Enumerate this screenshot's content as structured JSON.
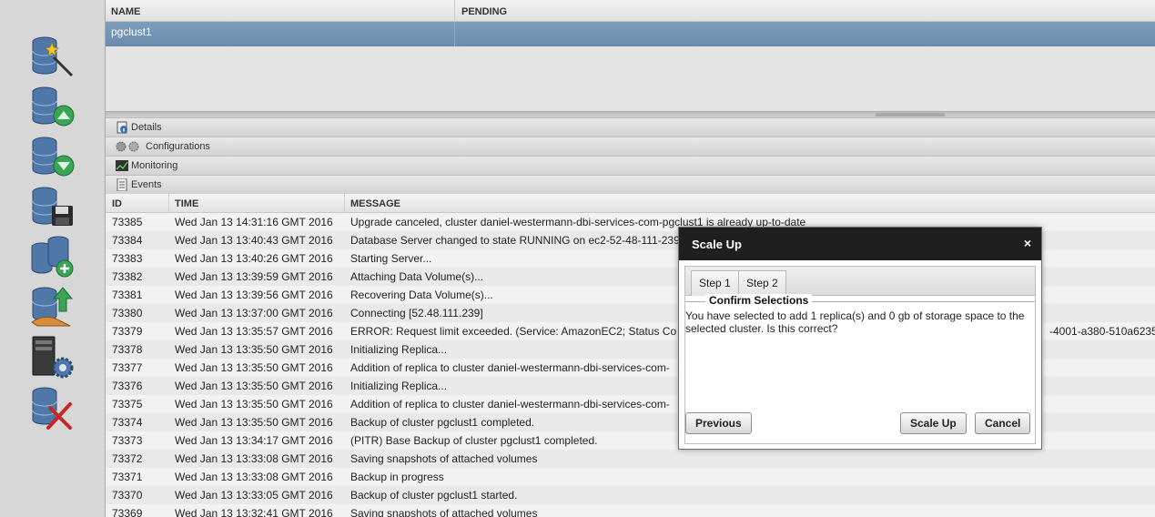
{
  "clusters": {
    "columns": [
      "NAME",
      "PENDING"
    ],
    "rows": [
      {
        "name": "pgclust1",
        "pending": ""
      }
    ]
  },
  "accordion": [
    {
      "label": "Details",
      "icon": "details-icon"
    },
    {
      "label": "Configurations",
      "icon": "configurations-icon"
    },
    {
      "label": "Monitoring",
      "icon": "monitoring-icon"
    },
    {
      "label": "Events",
      "icon": "events-icon"
    }
  ],
  "toolbar": [
    {
      "name": "create-cluster-button",
      "icon": "database-wand-icon"
    },
    {
      "name": "scale-up-button",
      "icon": "database-up-icon"
    },
    {
      "name": "scale-down-button",
      "icon": "database-down-icon"
    },
    {
      "name": "backup-button",
      "icon": "database-save-icon"
    },
    {
      "name": "add-replica-button",
      "icon": "database-add-icon"
    },
    {
      "name": "upgrade-button",
      "icon": "database-upgrade-icon"
    },
    {
      "name": "server-settings-button",
      "icon": "server-gear-icon"
    },
    {
      "name": "delete-cluster-button",
      "icon": "database-delete-icon"
    }
  ],
  "events": {
    "columns": [
      "ID",
      "TIME",
      "MESSAGE"
    ],
    "rows": [
      {
        "id": "73385",
        "time": "Wed Jan 13 14:31:16 GMT 2016",
        "message": "Upgrade canceled, cluster daniel-westermann-dbi-services-com-pgclust1 is already up-to-date"
      },
      {
        "id": "73384",
        "time": "Wed Jan 13 13:40:43 GMT 2016",
        "message": "Database Server changed to state RUNNING on ec2-52-48-111-239"
      },
      {
        "id": "73383",
        "time": "Wed Jan 13 13:40:26 GMT 2016",
        "message": "Starting Server..."
      },
      {
        "id": "73382",
        "time": "Wed Jan 13 13:39:59 GMT 2016",
        "message": "Attaching Data Volume(s)..."
      },
      {
        "id": "73381",
        "time": "Wed Jan 13 13:39:56 GMT 2016",
        "message": "Recovering Data Volume(s)..."
      },
      {
        "id": "73380",
        "time": "Wed Jan 13 13:37:00 GMT 2016",
        "message": "Connecting [52.48.111.239]"
      },
      {
        "id": "73379",
        "time": "Wed Jan 13 13:35:57 GMT 2016",
        "message": "ERROR: Request limit exceeded. (Service: AmazonEC2; Status Co"
      },
      {
        "id": "73378",
        "time": "Wed Jan 13 13:35:50 GMT 2016",
        "message": "Initializing Replica..."
      },
      {
        "id": "73377",
        "time": "Wed Jan 13 13:35:50 GMT 2016",
        "message": "Addition of replica to cluster daniel-westermann-dbi-services-com-"
      },
      {
        "id": "73376",
        "time": "Wed Jan 13 13:35:50 GMT 2016",
        "message": "Initializing Replica..."
      },
      {
        "id": "73375",
        "time": "Wed Jan 13 13:35:50 GMT 2016",
        "message": "Addition of replica to cluster daniel-westermann-dbi-services-com-"
      },
      {
        "id": "73374",
        "time": "Wed Jan 13 13:35:50 GMT 2016",
        "message": "Backup of cluster pgclust1 completed."
      },
      {
        "id": "73373",
        "time": "Wed Jan 13 13:34:17 GMT 2016",
        "message": "(PITR) Base Backup of cluster pgclust1 completed."
      },
      {
        "id": "73372",
        "time": "Wed Jan 13 13:33:08 GMT 2016",
        "message": "Saving snapshots of attached volumes"
      },
      {
        "id": "73371",
        "time": "Wed Jan 13 13:33:08 GMT 2016",
        "message": "Backup in progress"
      },
      {
        "id": "73370",
        "time": "Wed Jan 13 13:33:05 GMT 2016",
        "message": "Backup of cluster pgclust1 started."
      },
      {
        "id": "73369",
        "time": "Wed Jan 13 13:32:41 GMT 2016",
        "message": "Saving snapshots of attached volumes"
      }
    ],
    "overflow_text": "-4001-a380-510a6235"
  },
  "dialog": {
    "title": "Scale Up",
    "close": "×",
    "tabs": [
      "Step 1",
      "Step 2"
    ],
    "legend": "Confirm Selections",
    "text": "You have selected to add 1 replica(s) and 0 gb of storage space to the selected cluster. Is this correct?",
    "previous_label": "Previous",
    "scale_up_label": "Scale Up",
    "cancel_label": "Cancel"
  },
  "colors": {
    "selected_row": "#7393b3",
    "dialog_title_bg": "#1f1f1f",
    "scale_up_arrow": "#2f9e44",
    "scale_down_arrow": "#2f9e44",
    "delete_cross": "#c62828"
  }
}
